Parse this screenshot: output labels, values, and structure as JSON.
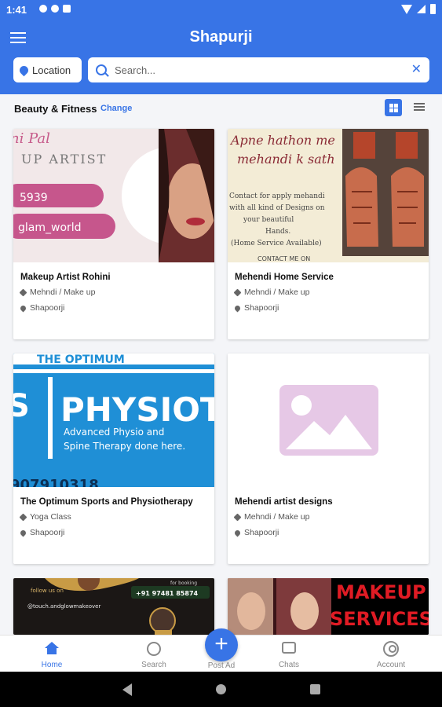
{
  "status_bar": {
    "time": "1:41"
  },
  "header": {
    "title": "Shapurji",
    "location_label": "Location",
    "search_placeholder": "Search..."
  },
  "filter": {
    "category": "Beauty & Fitness",
    "change_label": "Change"
  },
  "listings": [
    {
      "title": "Makeup Artist Rohini",
      "category": "Mehndi / Make up",
      "location": "Shapoorji",
      "image_text": [
        "ni Pal",
        "UP ARTIST",
        "5939",
        "glam_world"
      ]
    },
    {
      "title": "Mehendi Home Service",
      "category": "Mehndi / Make up",
      "location": "Shapoorji",
      "image_text": [
        "Apne hathon me",
        "mehandi k sath",
        "Contact for apply mehandi",
        "with all kind of Designs on",
        "your beautiful",
        "Hands.",
        "(Home Service Available)",
        "CONTACT ME ON"
      ]
    },
    {
      "title": "The Optimum Sports and Physiotherapy",
      "category": "Yoga Class",
      "location": "Shapoorji",
      "image_text": [
        "THE OPTIMUM",
        "PHYSIOT",
        "Advanced Physio and",
        "Spine Therapy done here.",
        "907910318"
      ]
    },
    {
      "title": "Mehendi artist designs",
      "category": "Mehndi / Make up",
      "location": "Shapoorji"
    },
    {
      "image_text": [
        "follow us on",
        "@touch.andglowmakeover",
        "+91 97481 85874",
        "for booking"
      ]
    },
    {
      "image_text": [
        "MAKEUP",
        "SERVICES"
      ]
    }
  ],
  "bottom_nav": {
    "home": "Home",
    "search": "Search",
    "post_ad": "Post Ad",
    "chats": "Chats",
    "account": "Account"
  },
  "colors": {
    "primary": "#3874e6",
    "placeholder": "#e6c8e6"
  }
}
